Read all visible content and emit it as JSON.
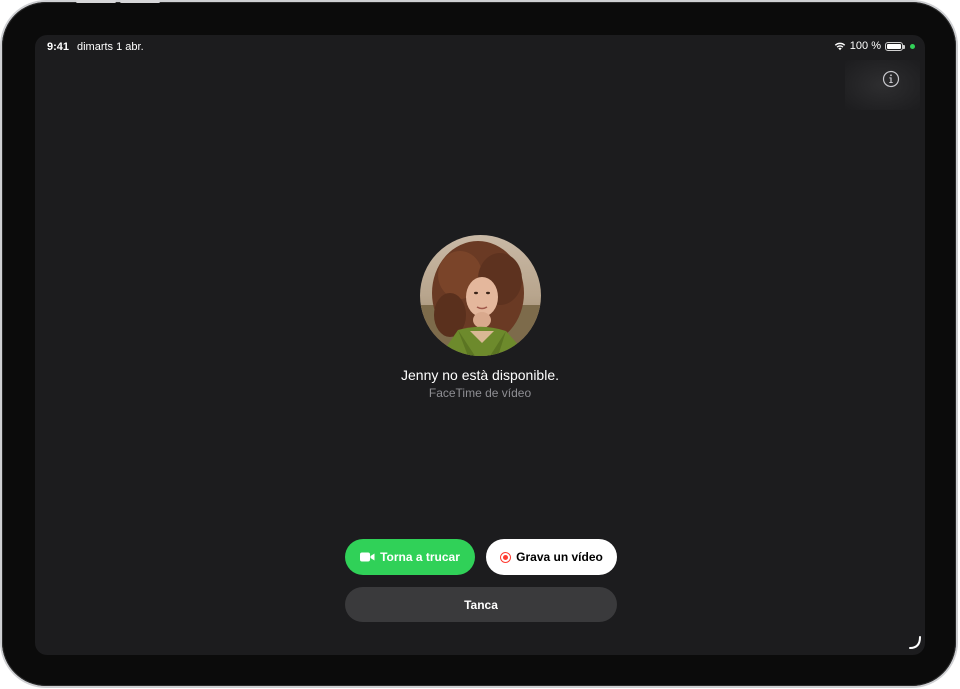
{
  "status_bar": {
    "time": "9:41",
    "date": "dimarts 1 abr.",
    "battery_percent": "100 %",
    "battery_level": 1.0,
    "wifi_icon": "wifi-icon",
    "recording_indicator_color": "#32d158"
  },
  "info_button": {
    "icon": "info-circle-icon"
  },
  "caller": {
    "name_message": "Jenny no està disponible.",
    "call_type": "FaceTime de vídeo",
    "avatar": "contact-photo"
  },
  "actions": {
    "callback_label": "Torna a trucar",
    "callback_icon": "video-camera-icon",
    "callback_color": "#30d158",
    "record_label": "Grava un vídeo",
    "record_icon": "record-icon",
    "record_icon_color": "#ff3b30",
    "close_label": "Tanca"
  },
  "colors": {
    "screen_background": "#1c1c1e",
    "secondary_text": "#8e8e93",
    "close_button_bg": "#3a3a3c"
  }
}
